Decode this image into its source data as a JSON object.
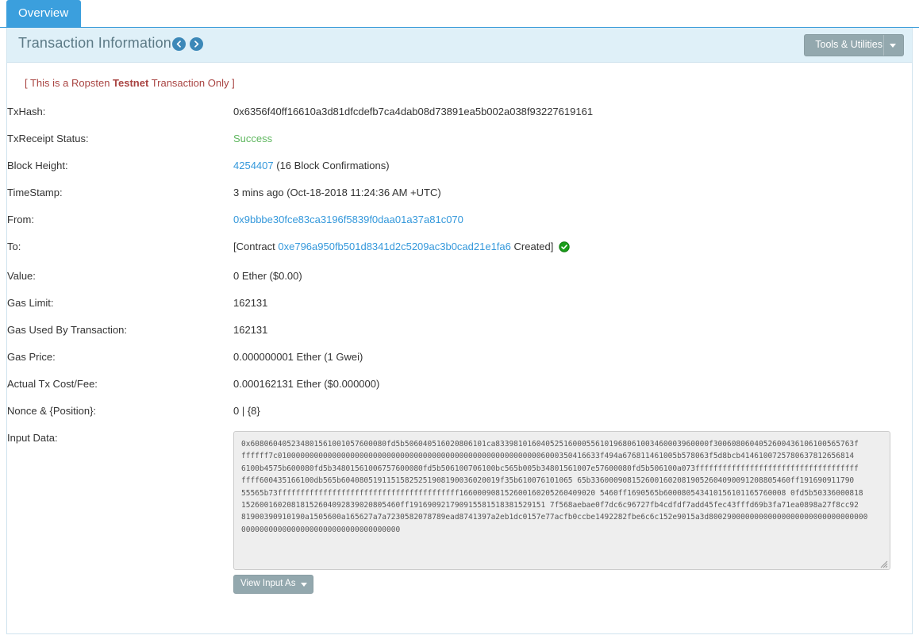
{
  "tabs": [
    {
      "label": "Overview",
      "active": true
    }
  ],
  "panel": {
    "title": "Transaction Information",
    "prev_icon": "chevron-left-circle-icon",
    "next_icon": "chevron-right-circle-icon",
    "tools_button": "Tools & Utilities"
  },
  "notice": {
    "prefix": "[ This is a Ropsten ",
    "emphasis": "Testnet",
    "suffix": " Transaction Only ]"
  },
  "fields": {
    "txhash_label": "TxHash:",
    "txhash_value": "0x6356f40ff16610a3d81dfcdefb7ca4dab08d73891ea5b002a038f93227619161",
    "status_label": "TxReceipt Status:",
    "status_value": "Success",
    "block_label": "Block Height:",
    "block_value": "4254407",
    "block_confirmations": "(16 Block Confirmations)",
    "timestamp_label": "TimeStamp:",
    "timestamp_value": "3 mins ago (Oct-18-2018 11:24:36 AM +UTC)",
    "from_label": "From:",
    "from_value": "0x9bbbe30fce83ca3196f5839f0daa01a37a81c070",
    "to_label": "To:",
    "to_prefix": "[Contract",
    "to_contract": "0xe796a950fb501d8341d2c5209ac3b0cad21e1fa6",
    "to_suffix": "Created]",
    "value_label": "Value:",
    "value_value": "0 Ether ($0.00)",
    "gaslimit_label": "Gas Limit:",
    "gaslimit_value": "162131",
    "gasused_label": "Gas Used By Transaction:",
    "gasused_value": "162131",
    "gasprice_label": "Gas Price:",
    "gasprice_value": "0.000000001 Ether (1 Gwei)",
    "txcost_label": "Actual Tx Cost/Fee:",
    "txcost_value": "0.000162131 Ether ($0.000000)",
    "nonce_label": "Nonce & {Position}:",
    "nonce_value": "0 | {8}",
    "inputdata_label": "Input Data:",
    "inputdata_value": "0x608060405234801561001057600080fd5b506040516020806101ca833981016040525160005561019680610034600039600f30060806040526004361061001056576 3fffffff7c0100000000000000000000000000000000000000000000000000000000600035041663f494a676811461005b578063f5d8bcb414610072578063f812656814\n6100b4575b600080fd5b348015610067576000 80fd5b506100706100bc565b005b34801561007e57600080fd5b506100a073ffffffffffffffffffffffffffffff\nfffff600435166100db565b6040805191151582525190819003602001905460ff1690565b33600090815260016020819052604090091208805460ff191690911790\n55565b73ffffffffffffffffffffffffffffffff1660009081526001602052604090205460ff1690565b60008054341015610116576000 80fd5b5033600081\n15260016020818152604092839020805460ff191690921790915581518381529151 7f568aebae0f7dc6c96727fb4cdfdf7add45fec43fffd69b3fa71ea0898a27f8cc92\n81900390910190a1505600a165627a7a72305820 78789ead8741397a2eb1dc0157e77acfb0ccbe1492282fbe6c6c152e9015a3d8002900000000000000000000000000000000\n00000000000000000000000000000000",
    "inputdata_lines": [
      "0x608060405234801561001057600080fd5b506040516020806101ca83398101604052516000556101968061003460003960000f3006080604052600436106100565763f",
      "ffffff7c01000000000000000000000000000000000000000000000000000000006000350416633f494a676811461005b578063f5d8bcb4146100725780637812656814",
      "6100b4575b600080fd5b34801561006757600080fd5b506100706100bc565b005b34801561007e57600080fd5b506100a073ffffffffffffffffffffffffffffffffffff",
      "ffff600435166100db565b60408051911515825251908190036020019f35b610076101065 65b33600090815260016020819052604090091208805460ff191690911790",
      "55565b73ffffffffffffffffffffffffffffffffffffffff166000908152600160205260409020 5460ff1690565b600080543410156101165760008 0fd5b50336000818",
      "15260016020818152604092839020805460ff191690921790915581518381529151 7f568aebae0f7dc6c96727fb4cdfdf7add45fec43fffd69b3fa71ea0898a27f8cc92",
      "81900390910190a1505600a165627a7a7230582078789ead8741397a2eb1dc0157e77acfb0ccbe1492282fbe6c6c152e9015a3d80029000000000000000000000000000000",
      "00000000000000000000000000000000000"
    ],
    "view_input_button": "View Input As"
  },
  "colors": {
    "accent": "#3b9fdd",
    "panel_header_bg": "#dff0f8",
    "link": "#3498db",
    "success": "#5fb75f",
    "notice": "#a94442",
    "button_bg": "#93a8ae"
  }
}
